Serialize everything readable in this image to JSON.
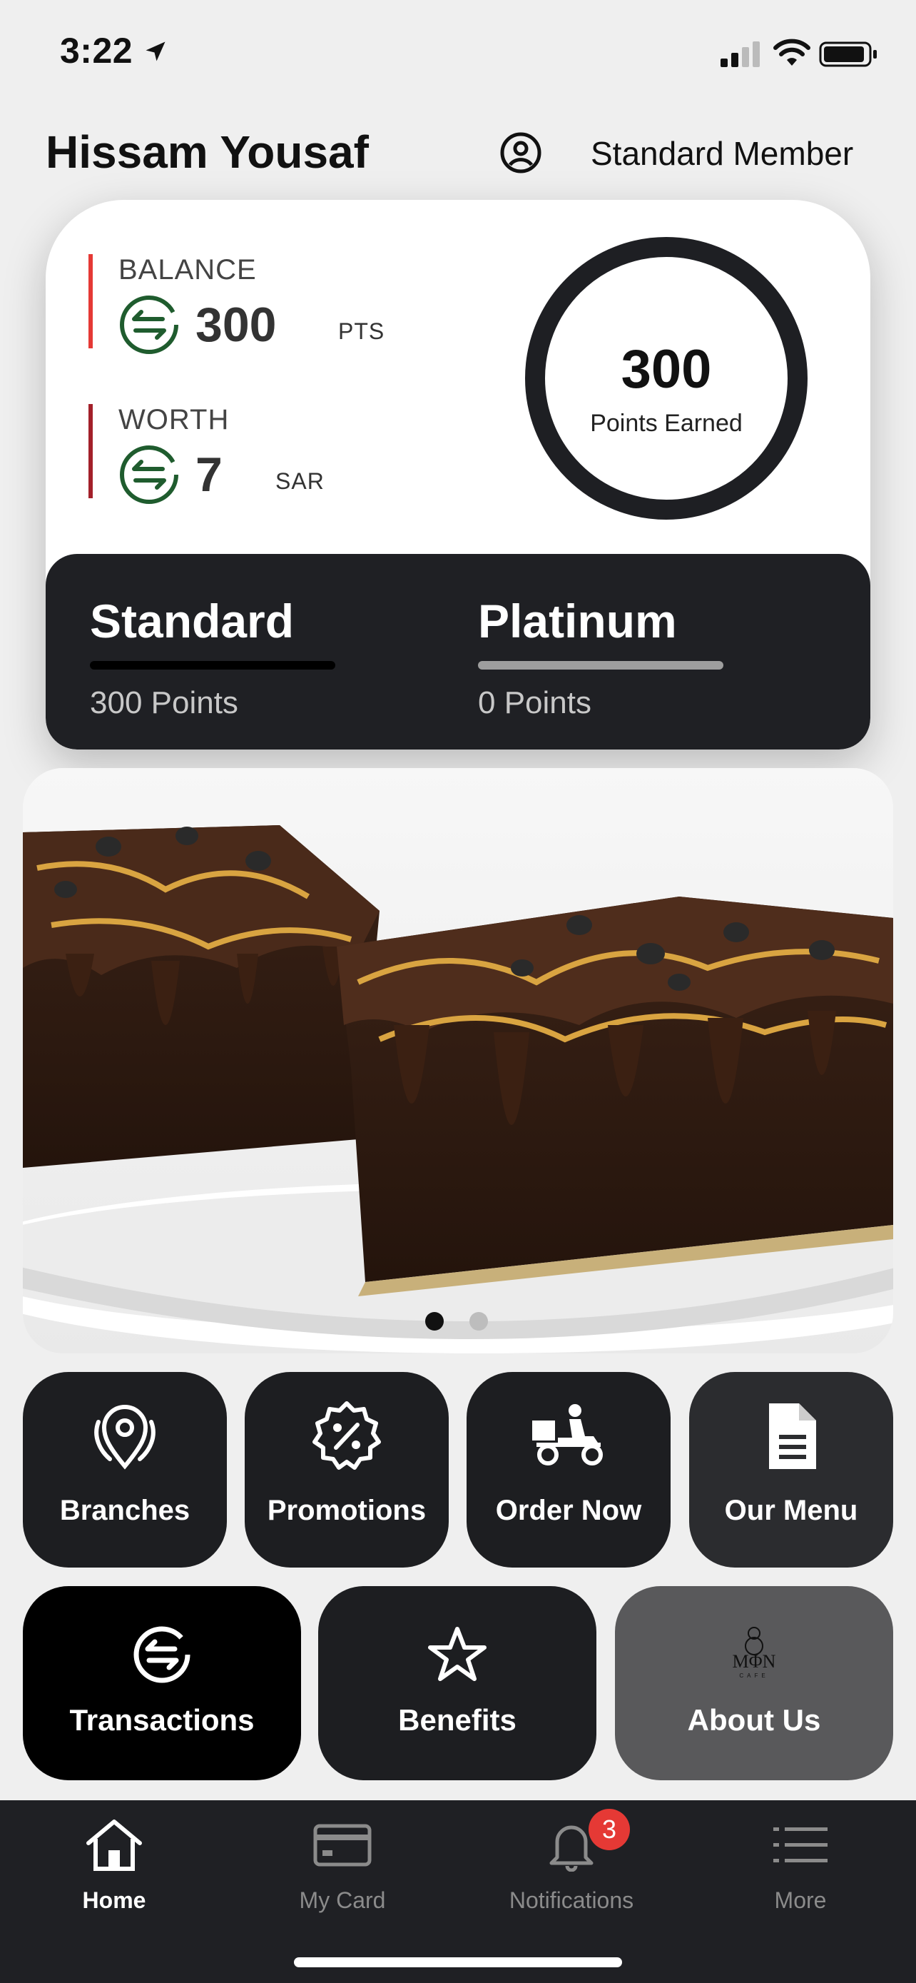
{
  "status_bar": {
    "time": "3:22"
  },
  "header": {
    "user_name": "Hissam Yousaf",
    "member_level": "Standard Member"
  },
  "loyalty": {
    "balance": {
      "label": "BALANCE",
      "value": "300",
      "unit": "PTS",
      "bar_color": "#e53935"
    },
    "worth": {
      "label": "WORTH",
      "value": "7",
      "unit": "SAR",
      "bar_color": "#a3202a"
    },
    "ring": {
      "value": "300",
      "label": "Points Earned"
    },
    "icon_color": "#1f5c2e",
    "tiers": [
      {
        "name": "Standard",
        "points": "300 Points",
        "line_color": "#000000"
      },
      {
        "name": "Platinum",
        "points": "0 Points",
        "line_color": "#9e9e9e"
      }
    ]
  },
  "banner": {
    "image": "chocolate-brownies-photo",
    "active_slide": 1,
    "slide_count": 2
  },
  "actions_row1": [
    {
      "label": "Branches",
      "icon": "location-pin-icon"
    },
    {
      "label": "Promotions",
      "icon": "discount-badge-icon"
    },
    {
      "label": "Order Now",
      "icon": "delivery-scooter-icon"
    },
    {
      "label": "Our Menu",
      "icon": "document-icon"
    }
  ],
  "actions_row2": [
    {
      "label": "Transactions",
      "icon": "exchange-arrows-icon"
    },
    {
      "label": "Benefits",
      "icon": "star-icon"
    },
    {
      "label": "About Us",
      "icon": "moon-cafe-logo"
    }
  ],
  "tabbar": {
    "items": [
      {
        "label": "Home",
        "icon": "house-icon",
        "active": true
      },
      {
        "label": "My Card",
        "icon": "credit-card-icon",
        "active": false
      },
      {
        "label": "Notifications",
        "icon": "bell-icon",
        "active": false,
        "badge": "3"
      },
      {
        "label": "More",
        "icon": "list-icon",
        "active": false
      }
    ]
  },
  "colors": {
    "card_dark": "#1f2024",
    "accent_green": "#1f5c2e",
    "badge_red": "#e53935"
  }
}
